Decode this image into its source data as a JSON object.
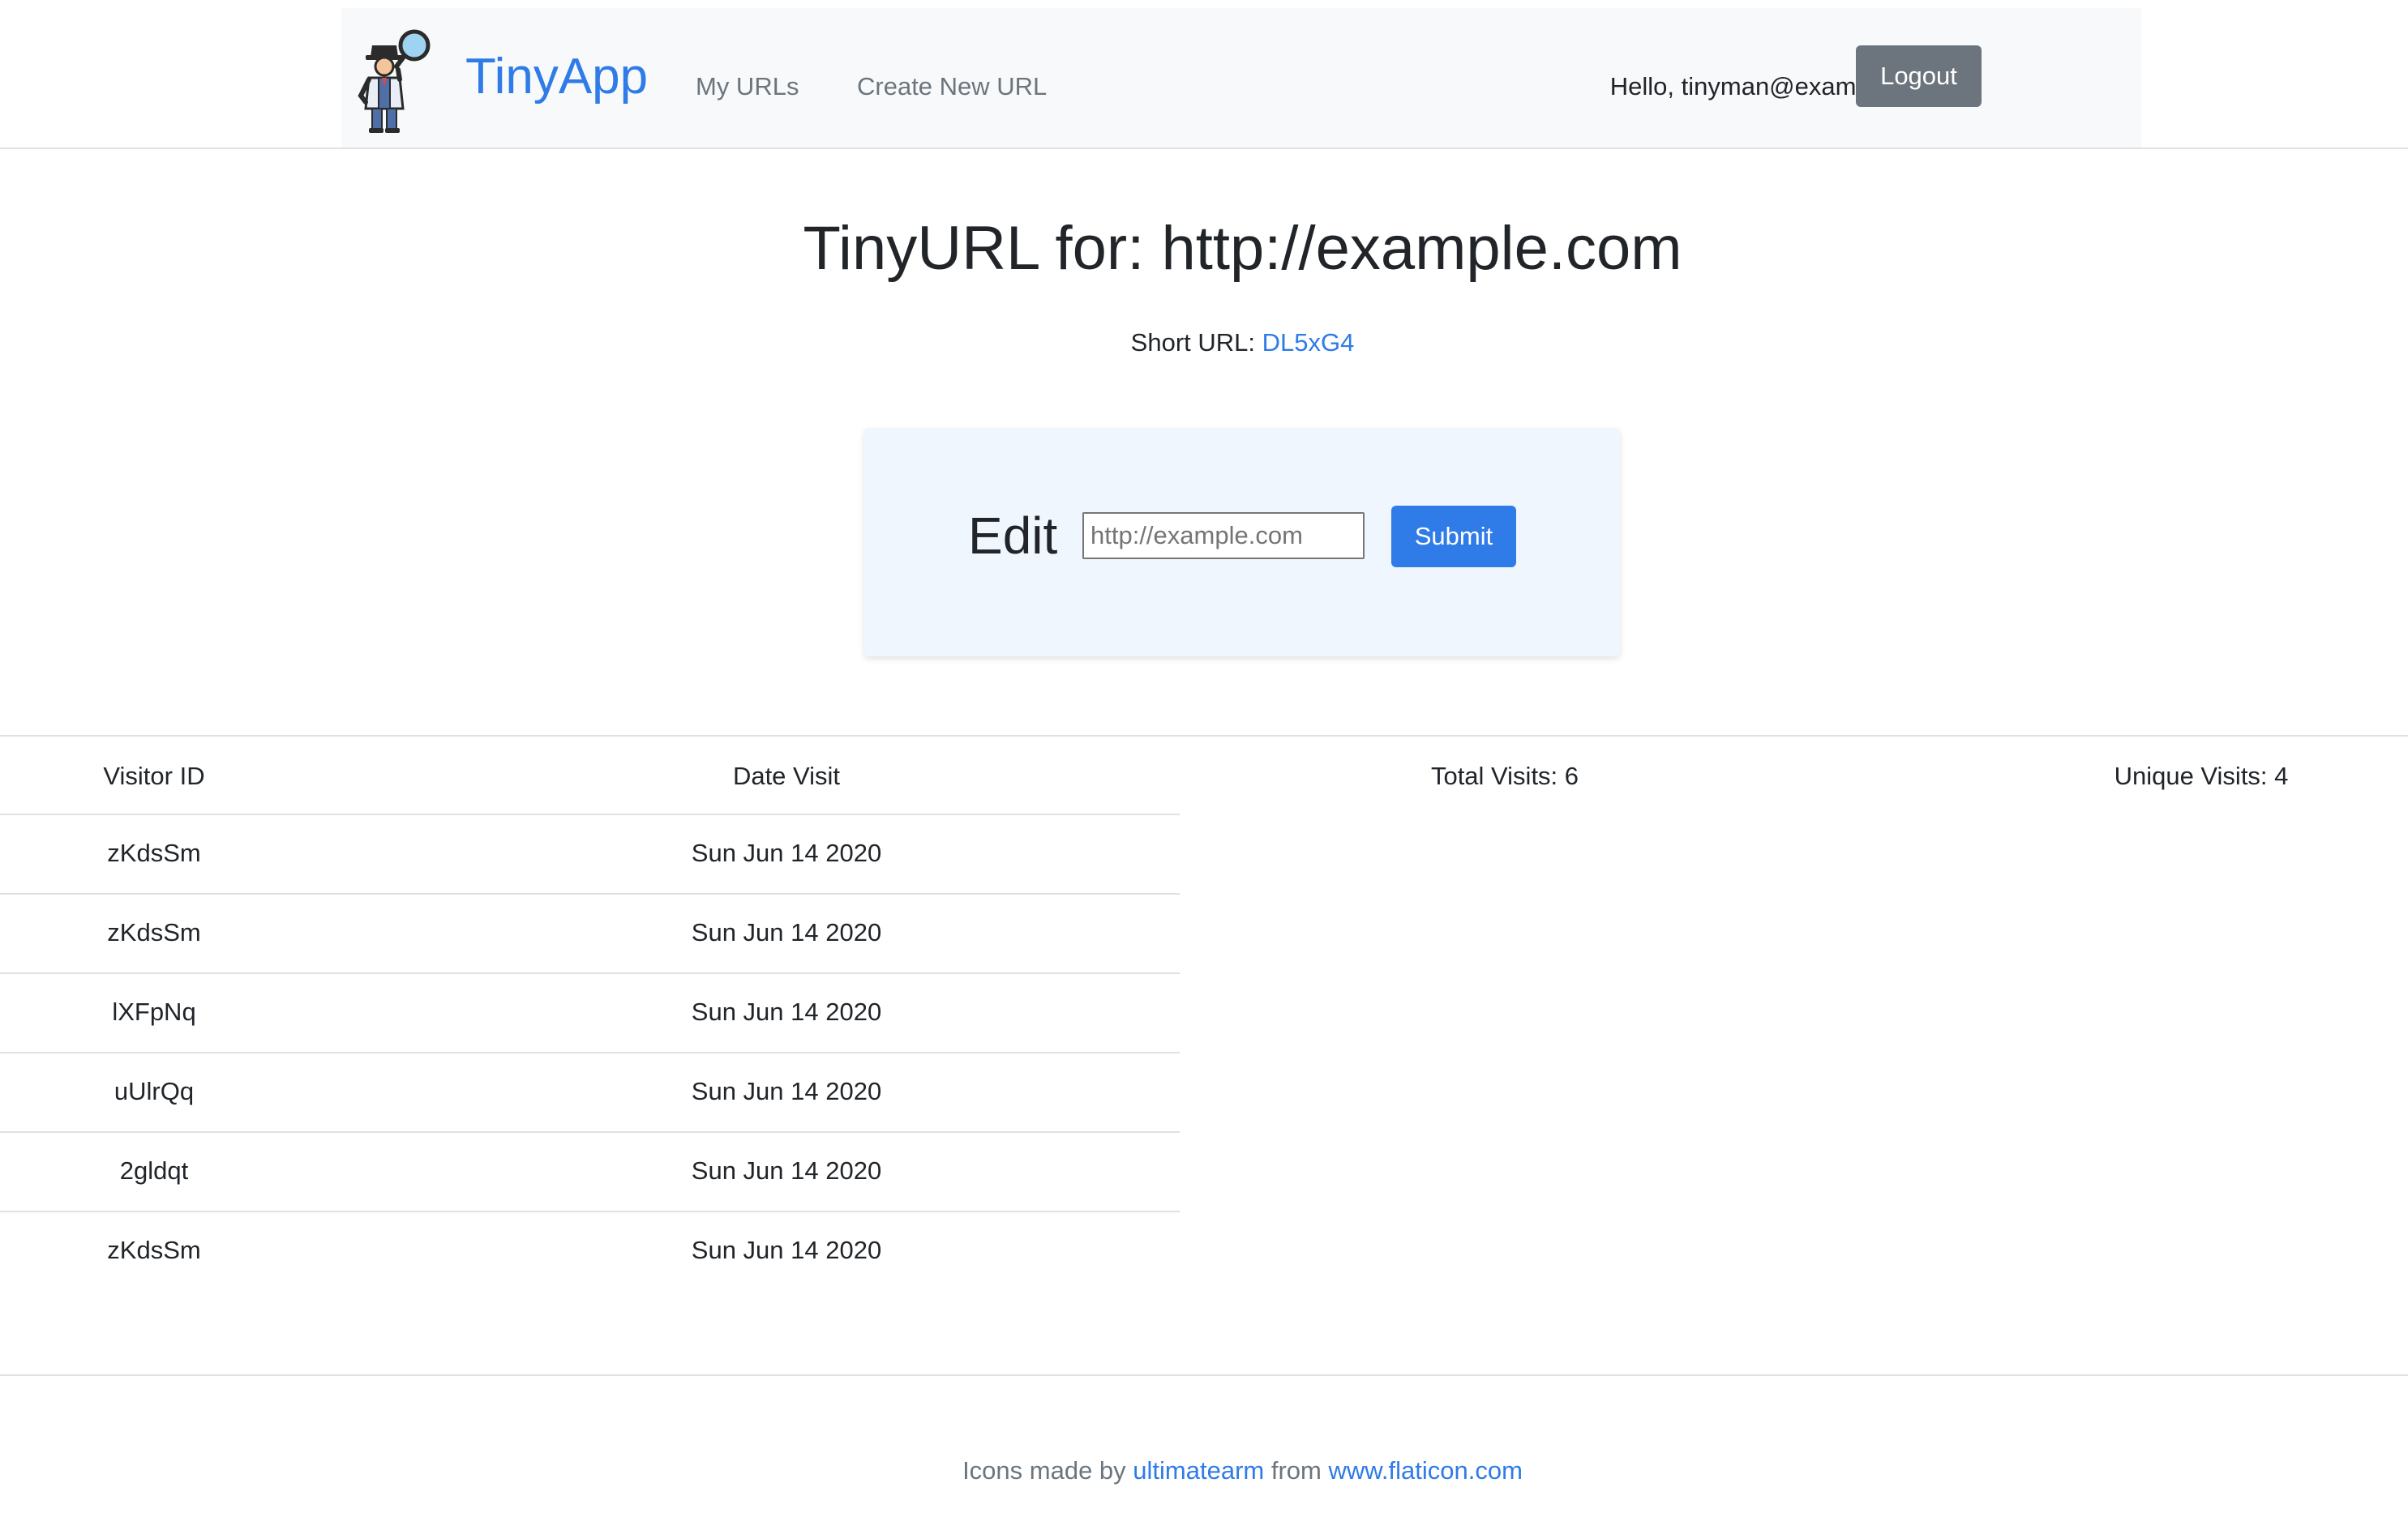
{
  "navbar": {
    "brand_name": "TinyApp",
    "links": [
      "My URLs",
      "Create New URL"
    ],
    "greeting": "Hello, tinyman@example.com",
    "logout_label": "Logout"
  },
  "page": {
    "title": "TinyURL for: http://example.com",
    "short_url_label": "Short URL: ",
    "short_url_value": "DL5xG4"
  },
  "edit_form": {
    "label": "Edit",
    "input_placeholder": "http://example.com",
    "submit_label": "Submit"
  },
  "visits": {
    "headers": {
      "visitor_id": "Visitor ID",
      "date_visit": "Date Visit",
      "total_visits": "Total Visits: 6",
      "unique_visits": "Unique Visits: 4"
    },
    "rows": [
      {
        "visitor_id": "zKdsSm",
        "date": "Sun Jun 14 2020"
      },
      {
        "visitor_id": "zKdsSm",
        "date": "Sun Jun 14 2020"
      },
      {
        "visitor_id": "lXFpNq",
        "date": "Sun Jun 14 2020"
      },
      {
        "visitor_id": "uUlrQq",
        "date": "Sun Jun 14 2020"
      },
      {
        "visitor_id": "2gldqt",
        "date": "Sun Jun 14 2020"
      },
      {
        "visitor_id": "zKdsSm",
        "date": "Sun Jun 14 2020"
      }
    ]
  },
  "footer": {
    "prefix": "Icons made by ",
    "author_link": "ultimatearm",
    "middle": " from ",
    "site_link": "www.flaticon.com"
  },
  "colors": {
    "brand": "#2f7be8",
    "navbar_bg": "#f8f9fa",
    "secondary": "#6c757d",
    "card_bg": "#f0f6fd"
  },
  "icons": {
    "brand_logo": "detective-with-magnifying-glass-icon"
  }
}
